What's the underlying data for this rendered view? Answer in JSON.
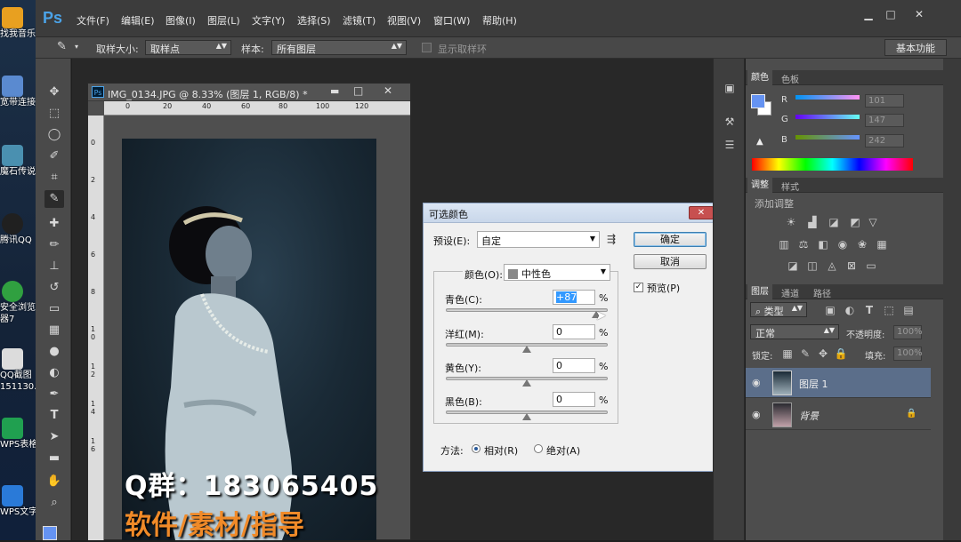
{
  "desktop": {
    "icons": [
      {
        "label": "找我音乐",
        "icon": "music-icon",
        "color": "#e8a020"
      },
      {
        "label": "宽带连接",
        "icon": "network-icon",
        "color": "#5a8ad0"
      },
      {
        "label": "魔石传说",
        "icon": "game-icon",
        "color": "#4a90b0"
      },
      {
        "label": "腾讯QQ",
        "icon": "qq-icon",
        "color": "#202020"
      },
      {
        "label": "安全浏览",
        "label2": "器7",
        "icon": "browser-icon",
        "color": "#30a040"
      },
      {
        "label": "QQ截图",
        "label2": "151130...",
        "icon": "image-file-icon",
        "color": "#dcdcdc"
      },
      {
        "label": "WPS表格",
        "icon": "wps-sheet-icon",
        "color": "#20a050"
      },
      {
        "label": "WPS文字",
        "icon": "wps-writer-icon",
        "color": "#2a7ad8"
      }
    ]
  },
  "app": {
    "logo": "Ps",
    "menu": [
      "文件(F)",
      "编辑(E)",
      "图像(I)",
      "图层(L)",
      "文字(Y)",
      "选择(S)",
      "滤镜(T)",
      "视图(V)",
      "窗口(W)",
      "帮助(H)"
    ],
    "window_buttons": [
      "▁",
      "□",
      "✕"
    ]
  },
  "options": {
    "sample_size_label": "取样大小:",
    "sample_size_value": "取样点",
    "sample_label": "样本:",
    "sample_value": "所有图层",
    "show_ring_label": "显示取样环",
    "workspace": "基本功能"
  },
  "document": {
    "title": "IMG_0134.JPG @ 8.33% (图层 1, RGB/8) *",
    "ruler_top": [
      "0",
      "20",
      "40",
      "60",
      "80",
      "100",
      "120"
    ],
    "ruler_left": [
      "0",
      "2",
      "4",
      "6",
      "8",
      "10",
      "12",
      "14",
      "16"
    ],
    "window_buttons": [
      "▬",
      "□",
      "✕"
    ]
  },
  "overlay": {
    "line1": "Q群：183065405",
    "line2": "软件/素材/指导"
  },
  "dialog": {
    "title": "可选颜色",
    "close": "✕",
    "preset_label": "预设(E):",
    "preset_value": "自定",
    "ok": "确定",
    "cancel": "取消",
    "preview_label": "预览(P)",
    "preview_checked": "✓",
    "colors_label": "颜色(O):",
    "colors_value": "中性色",
    "sliders": [
      {
        "label": "青色(C):",
        "value": "+87",
        "unit": "%",
        "level": 87
      },
      {
        "label": "洋红(M):",
        "value": "0",
        "unit": "%",
        "level": 0
      },
      {
        "label": "黄色(Y):",
        "value": "0",
        "unit": "%",
        "level": 0
      },
      {
        "label": "黑色(B):",
        "value": "0",
        "unit": "%",
        "level": 0
      }
    ],
    "method_label": "方法:",
    "method_relative": "相对(R)",
    "method_absolute": "绝对(A)"
  },
  "color_panel": {
    "tabs": [
      "颜色",
      "色板"
    ],
    "r_label": "R",
    "r_value": "101",
    "g_label": "G",
    "g_value": "147",
    "b_label": "B",
    "b_value": "242",
    "fg_color": "#6593f2"
  },
  "adjust_panel": {
    "tabs": [
      "调整",
      "样式"
    ],
    "add_label": "添加调整"
  },
  "layers_panel": {
    "tabs": [
      "图层",
      "通道",
      "路径"
    ],
    "filter_label": "类型",
    "blend_mode": "正常",
    "opacity_label": "不透明度:",
    "opacity_value": "100%",
    "lock_label": "锁定:",
    "fill_label": "填充:",
    "fill_value": "100%",
    "layers": [
      {
        "name": "图层 1",
        "selected": true
      },
      {
        "name": "背景",
        "locked": true
      }
    ]
  }
}
